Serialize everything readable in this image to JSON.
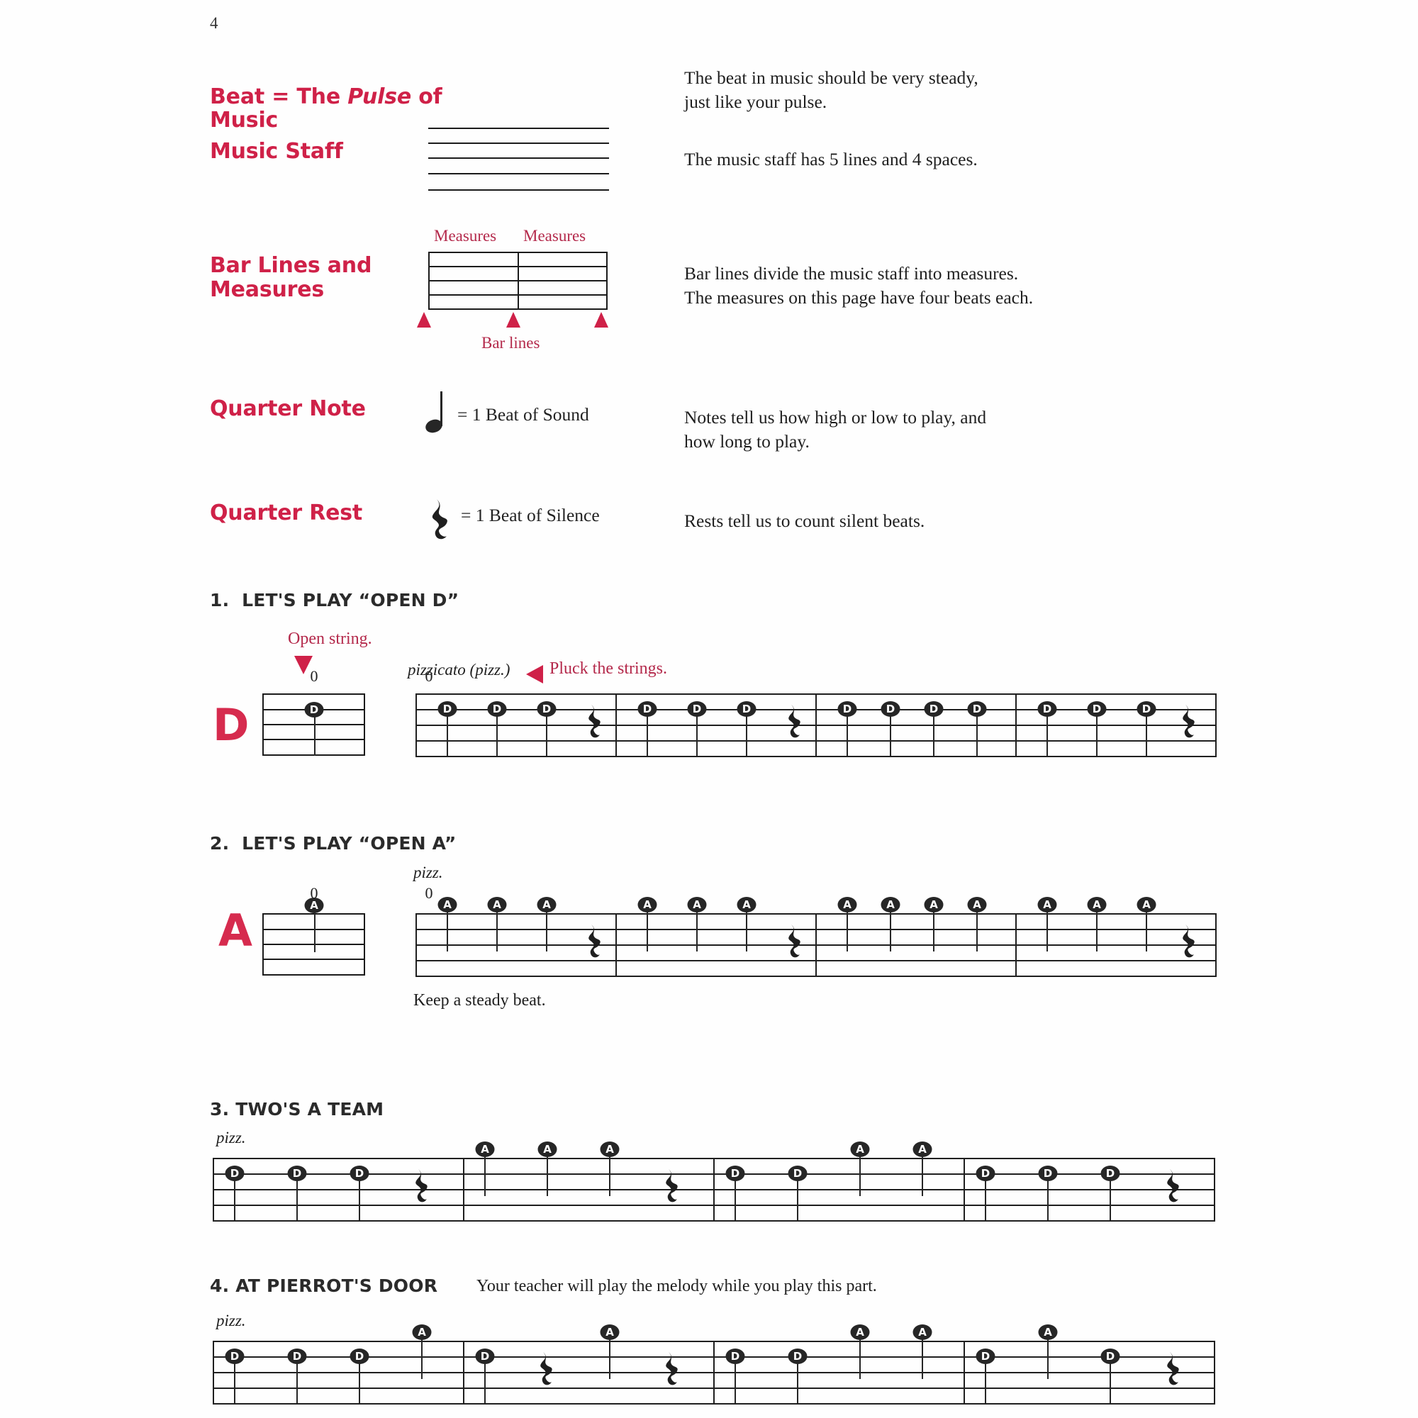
{
  "page_number": "4",
  "concepts": [
    {
      "title": "Beat = The Pulse of Music",
      "title_plain": "Beat = The ",
      "title_italic": "Pulse",
      "title_tail": " of Music",
      "body": "The beat in music should be very steady,\njust like your pulse.",
      "figure": "none"
    },
    {
      "title": "Music Staff",
      "body": "The music staff has 5 lines and 4 spaces.",
      "figure": "five-line-staff"
    },
    {
      "title": "Bar Lines and\nMeasures",
      "body": "Bar lines divide the music staff into measures.\nThe measures on this page have four beats each.",
      "figure": "measures-diagram",
      "figure_labels": {
        "measure_left": "Measures",
        "measure_right": "Measures",
        "bar_lines": "Bar lines"
      }
    },
    {
      "title": "Quarter Note",
      "symbol": "quarter-note",
      "symbol_caption": "= 1 Beat of Sound",
      "body": "Notes tell us how high or low to play, and\nhow long to play.",
      "figure": "quarter-note"
    },
    {
      "title": "Quarter Rest",
      "symbol": "quarter-rest",
      "symbol_caption": "= 1 Beat of Silence",
      "body": "Rests tell us to count silent beats.",
      "figure": "quarter-rest"
    }
  ],
  "exercises": [
    {
      "number": "1.",
      "title": "LET'S PLAY “OPEN D”",
      "subtitle": "",
      "string_letter": "D",
      "annotations": {
        "open_string": "Open string.",
        "pizzicato": "pizzicato (pizz.)",
        "pluck": "Pluck the strings.",
        "finger_number": "0"
      },
      "pickup_note": {
        "label": "D",
        "finger": "0"
      },
      "measures": [
        {
          "events": [
            "D",
            "D",
            "D",
            "rest"
          ]
        },
        {
          "events": [
            "D",
            "D",
            "D",
            "rest"
          ]
        },
        {
          "events": [
            "D",
            "D",
            "D",
            "D"
          ]
        },
        {
          "events": [
            "D",
            "D",
            "D",
            "rest"
          ]
        }
      ]
    },
    {
      "number": "2.",
      "title": "LET'S PLAY “OPEN A”",
      "subtitle": "",
      "string_letter": "A",
      "annotations": {
        "pizzicato": "pizz.",
        "finger_number": "0",
        "footnote": "Keep a steady beat."
      },
      "pickup_note": {
        "label": "A",
        "finger": "0"
      },
      "measures": [
        {
          "events": [
            "A",
            "A",
            "A",
            "rest"
          ]
        },
        {
          "events": [
            "A",
            "A",
            "A",
            "rest"
          ]
        },
        {
          "events": [
            "A",
            "A",
            "A",
            "A"
          ]
        },
        {
          "events": [
            "A",
            "A",
            "A",
            "rest"
          ]
        }
      ]
    },
    {
      "number": "3.",
      "title": "TWO'S A TEAM",
      "subtitle": "",
      "string_letter": "",
      "annotations": {
        "pizzicato": "pizz."
      },
      "measures": [
        {
          "events": [
            "D",
            "D",
            "D",
            "rest"
          ]
        },
        {
          "events": [
            "A",
            "A",
            "A",
            "rest"
          ]
        },
        {
          "events": [
            "D",
            "D",
            "A",
            "A"
          ]
        },
        {
          "events": [
            "D",
            "D",
            "D",
            "rest"
          ]
        }
      ]
    },
    {
      "number": "4.",
      "title": "AT PIERROT'S DOOR",
      "subtitle": "Your teacher will play the melody while you play this part.",
      "string_letter": "",
      "annotations": {
        "pizzicato": "pizz."
      },
      "measures": [
        {
          "events": [
            "D",
            "D",
            "D",
            "A"
          ]
        },
        {
          "events": [
            "D",
            "rest",
            "A",
            "rest"
          ]
        },
        {
          "events": [
            "D",
            "D",
            "A",
            "A"
          ]
        },
        {
          "events": [
            "D",
            "A",
            "D",
            "rest"
          ]
        }
      ]
    }
  ],
  "glyphs": {
    "quarter_note": "♩",
    "quarter_rest": "𝄽"
  },
  "colors": {
    "accent_red": "#cf2148",
    "heading_black": "#2b2b2b",
    "ink": "#1f1f1f"
  }
}
